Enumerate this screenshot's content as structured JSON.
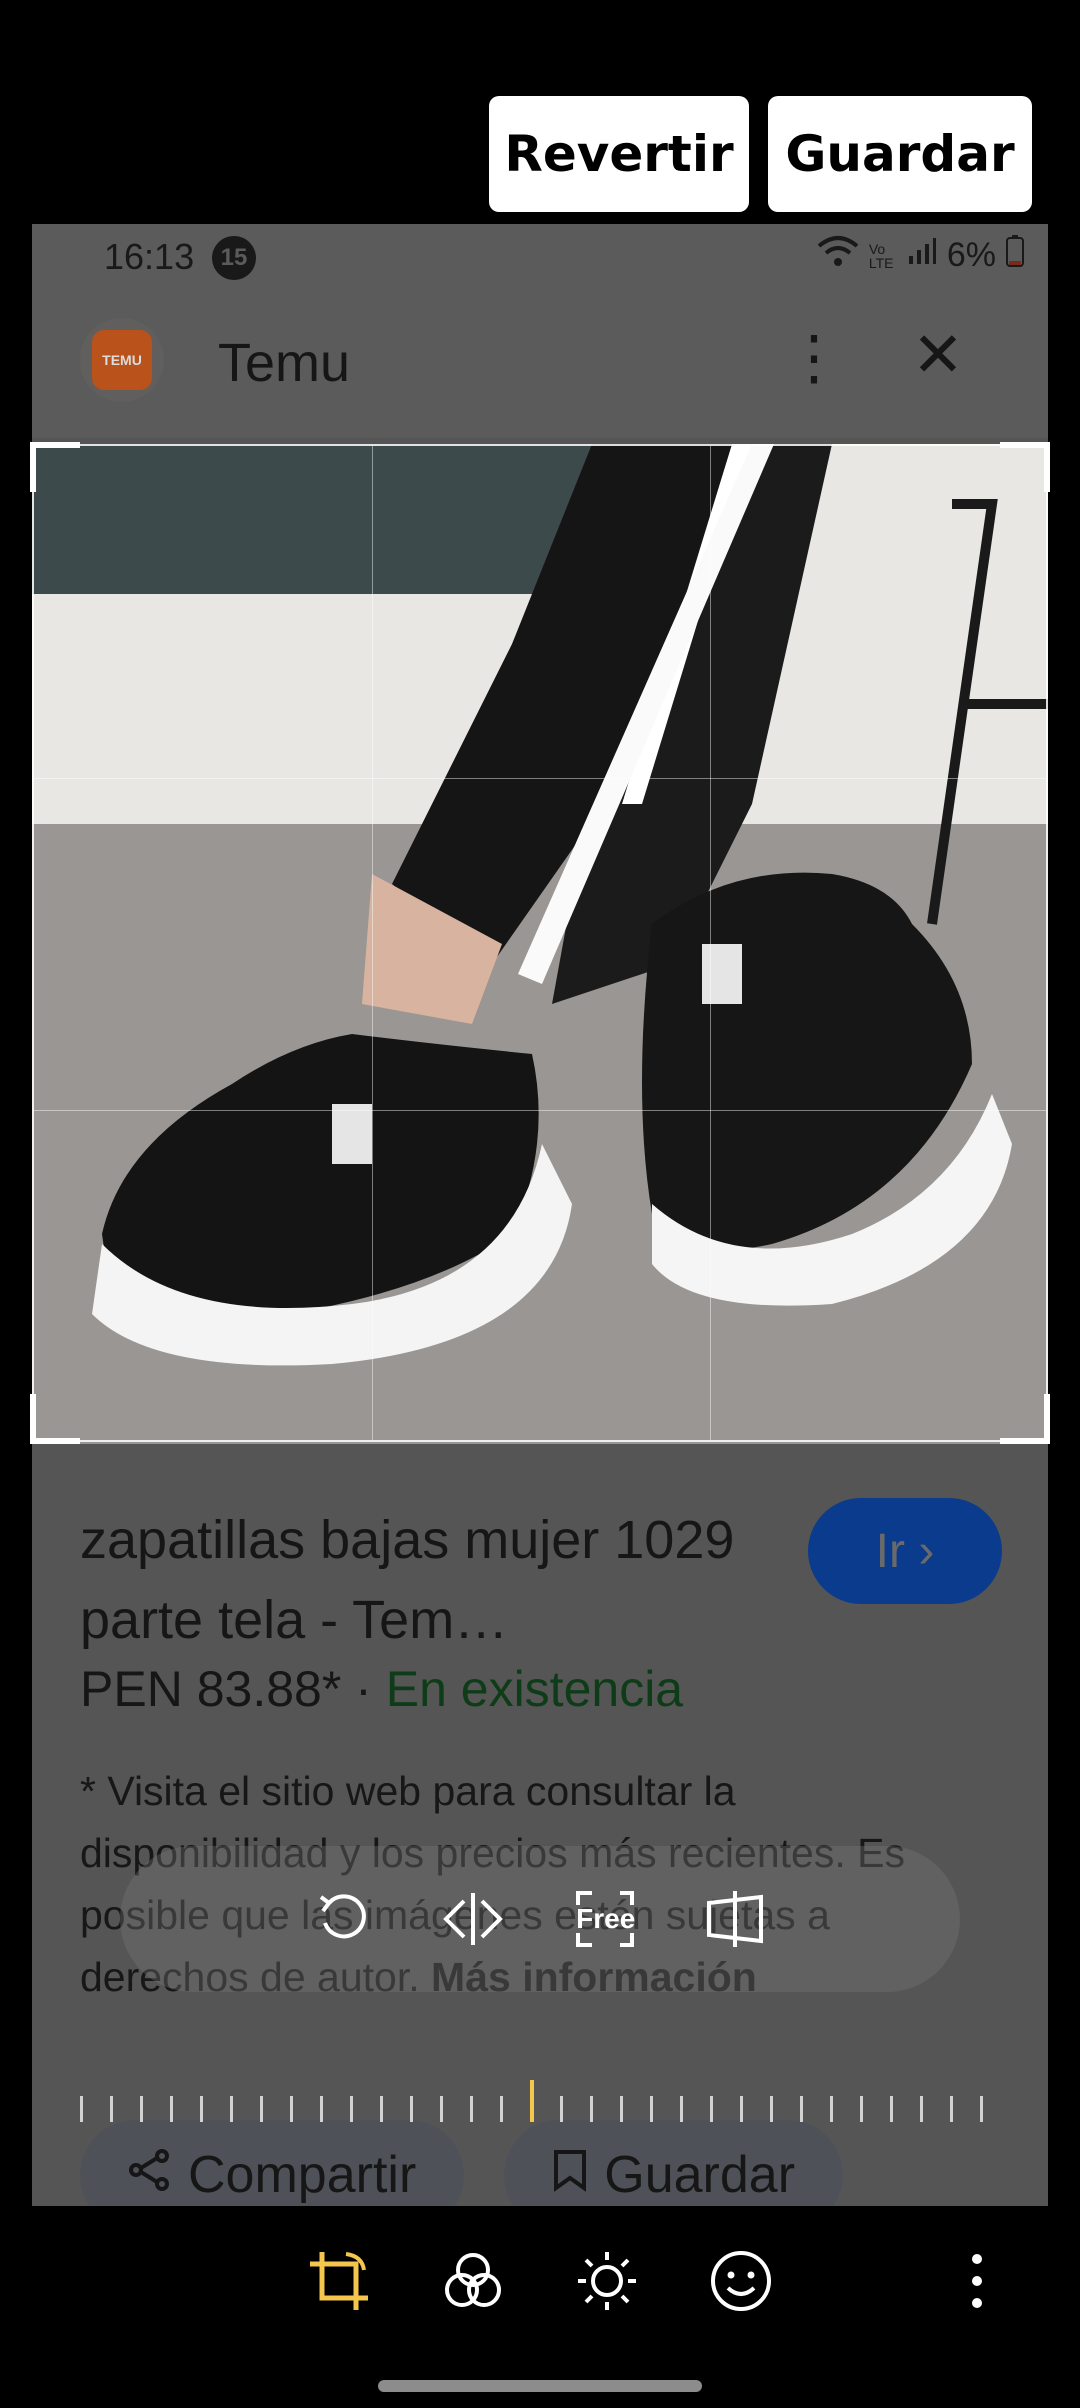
{
  "actions": {
    "revert": "Revertir",
    "save": "Guardar"
  },
  "status": {
    "time": "16:13",
    "notif": "15",
    "battery": "6%",
    "net": "Vo LTE"
  },
  "header": {
    "app": "Temu",
    "logo_text": "TEMU"
  },
  "product": {
    "title": "zapatillas bajas mujer 1029 parte tela - Tem…",
    "go": "Ir ›",
    "price": "PEN 83.88*",
    "sep": " · ",
    "stock": "En existencia",
    "note": "* Visita el sitio web para consultar la disponibilidad y los precios más recientes. Es posible que las imágenes estén sujetas a derechos de autor.",
    "more": "Más información",
    "share": "Compartir",
    "save": "Guardar"
  },
  "overlay": {
    "free": "Free"
  },
  "colors": {
    "accent": "#f4c64c",
    "stock": "#2f8a43",
    "link": "#0b3b8c"
  }
}
